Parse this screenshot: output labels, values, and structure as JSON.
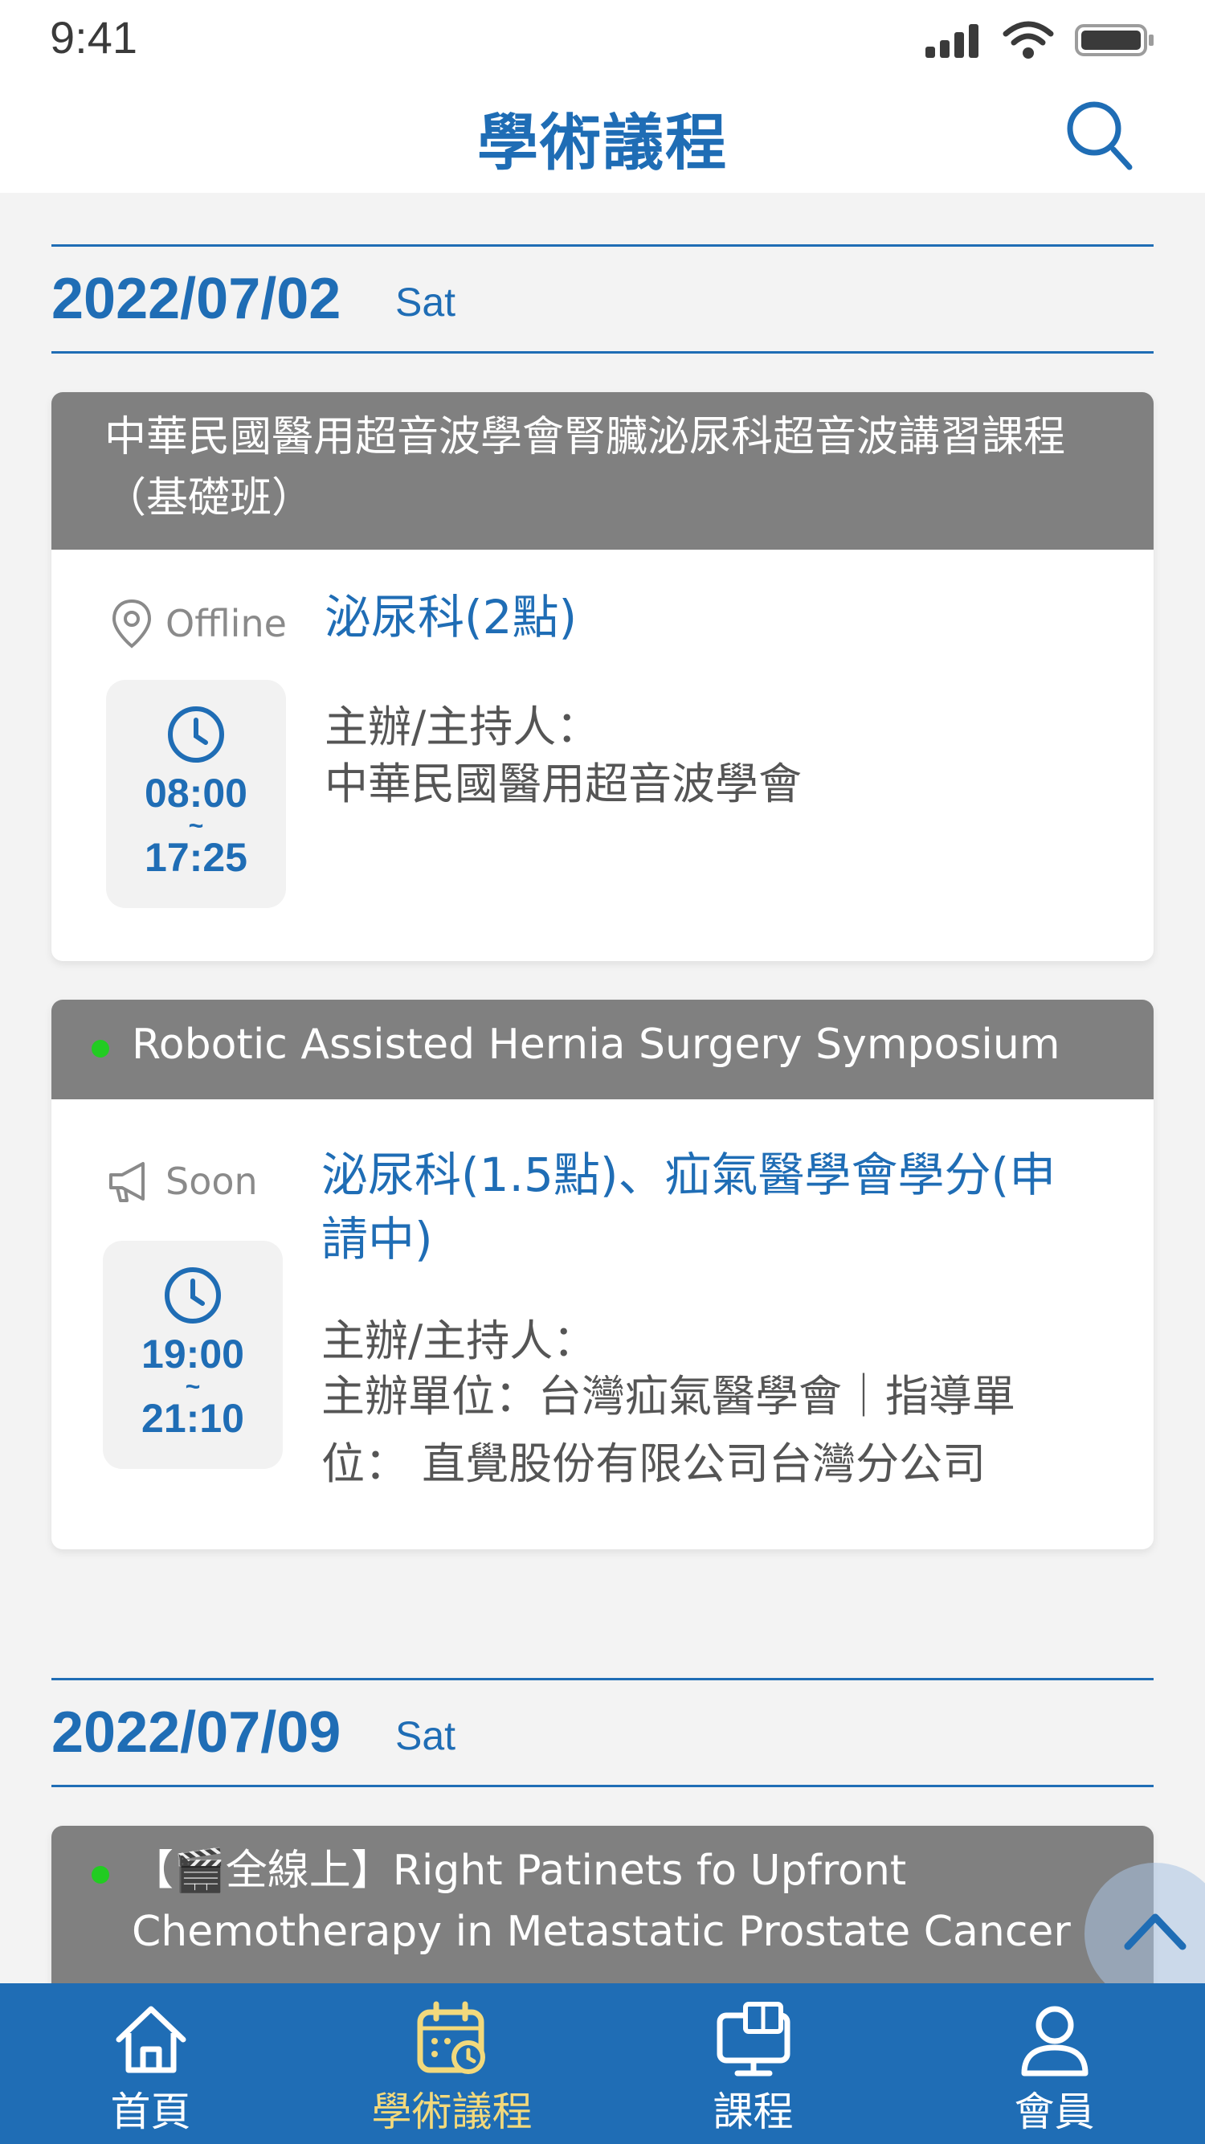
{
  "status_bar": {
    "time": "9:41"
  },
  "header": {
    "title": "學術議程"
  },
  "days": [
    {
      "date": "2022/07/02",
      "weekday": "Sat"
    },
    {
      "date": "2022/07/09",
      "weekday": "Sat"
    }
  ],
  "events": [
    {
      "title": "中華民國醫用超音波學會腎臟泌尿科超音波講習課程（基礎班）",
      "status": "Offline",
      "start": "08:00",
      "sep": "~",
      "end": "17:25",
      "credits": "泌尿科(2點)",
      "host_label": "主辦/主持人：",
      "host": "中華民國醫用超音波學會"
    },
    {
      "title": "Robotic Assisted Hernia Surgery Symposium",
      "status": "Soon",
      "start": "19:00",
      "sep": "~",
      "end": "21:10",
      "credits": "泌尿科(1.5點)、疝氣醫學會學分(申請中)",
      "host_label": "主辦/主持人：",
      "host": "主辦單位：台灣疝氣醫學會｜指導單位： 直覺股份有限公司台灣分公司"
    },
    {
      "title": "【🎬全線上】Right Patinets fo Upfront Chemotherapy in Metastatic Prostate Cancer"
    }
  ],
  "tabs": [
    {
      "label": "首頁",
      "icon": "home-icon"
    },
    {
      "label": "學術議程",
      "icon": "calendar-icon",
      "active": true
    },
    {
      "label": "課程",
      "icon": "monitor-icon"
    },
    {
      "label": "會員",
      "icon": "user-icon"
    }
  ],
  "colors": {
    "accent": "#1f6db5",
    "header_gray": "#808080",
    "active_tab": "#f2d97c",
    "live_dot": "#22cc22"
  }
}
